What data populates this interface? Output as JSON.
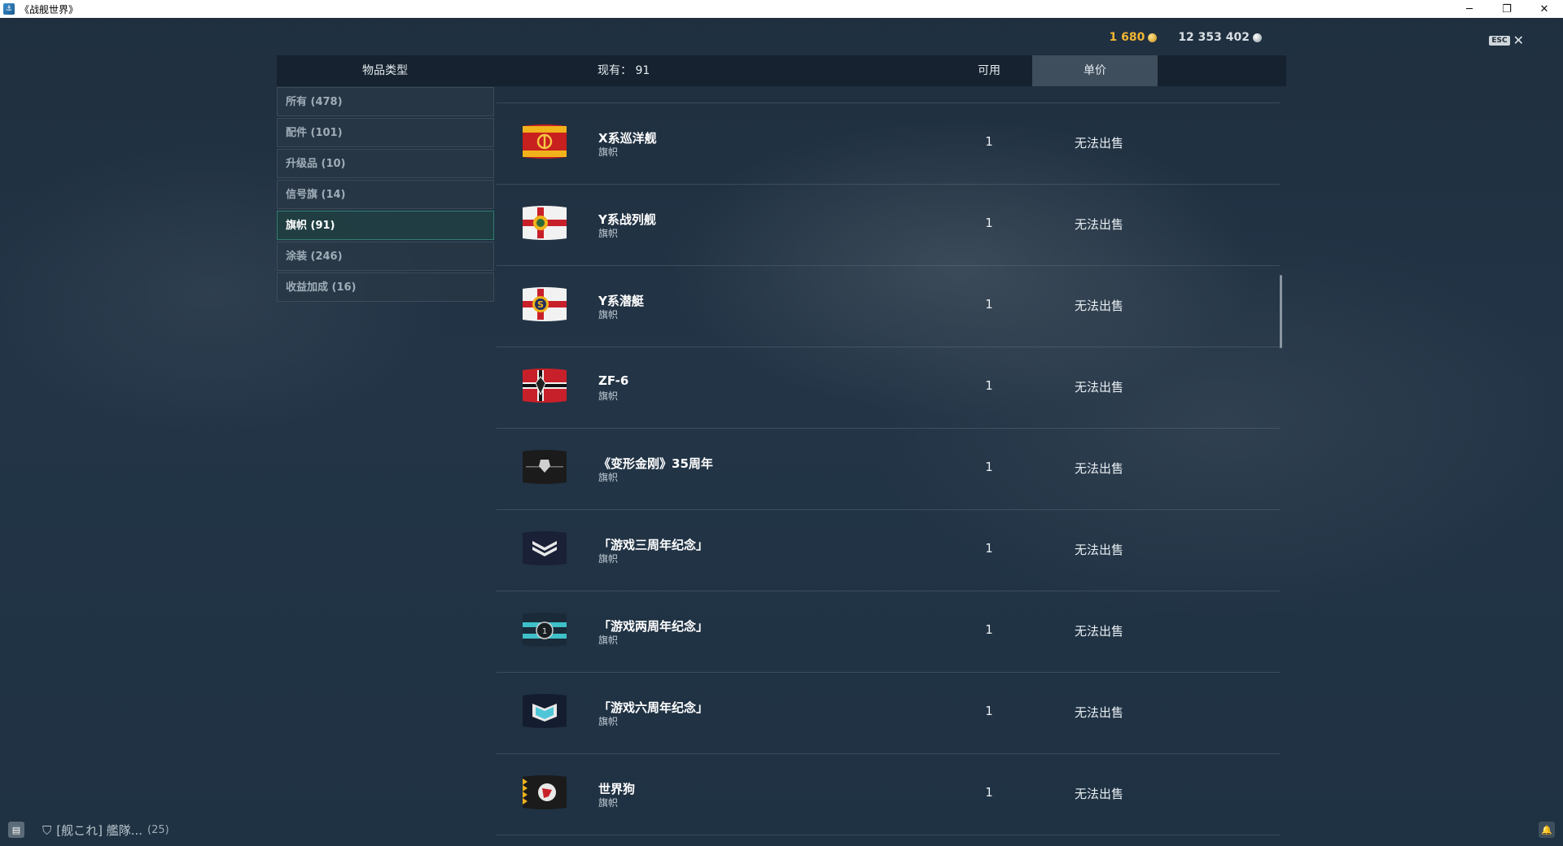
{
  "window": {
    "title": "《战舰世界》",
    "controls": {
      "minimize": "─",
      "restore": "❐",
      "close": "✕"
    }
  },
  "currency": {
    "gold": "1 680",
    "silver": "12 353 402"
  },
  "esc": {
    "badge": "ESC",
    "close": "✕"
  },
  "header": {
    "item_type": "物品类型",
    "count": "现有： 91",
    "available": "可用",
    "unit_price": "单价"
  },
  "categories": [
    {
      "label": "所有 (478)",
      "active": false
    },
    {
      "label": "配件 (101)",
      "active": false
    },
    {
      "label": "升级品 (10)",
      "active": false
    },
    {
      "label": "信号旗 (14)",
      "active": false
    },
    {
      "label": "旗帜 (91)",
      "active": true
    },
    {
      "label": "涂装 (246)",
      "active": false
    },
    {
      "label": "收益加成 (16)",
      "active": false
    }
  ],
  "items": [
    {
      "name": "X系巡洋舰",
      "type": "旗帜",
      "qty": "1",
      "price": "无法出售",
      "icon": "red-anchor-flag"
    },
    {
      "name": "Y系战列舰",
      "type": "旗帜",
      "qty": "1",
      "price": "无法出售",
      "icon": "white-cross-crest-flag"
    },
    {
      "name": "Y系潜艇",
      "type": "旗帜",
      "qty": "1",
      "price": "无法出售",
      "icon": "white-cross-s-emblem-flag"
    },
    {
      "name": "ZF-6",
      "type": "旗帜",
      "qty": "1",
      "price": "无法出售",
      "icon": "red-black-cross-emblem-flag"
    },
    {
      "name": "《变形金刚》35周年",
      "type": "旗帜",
      "qty": "1",
      "price": "无法出售",
      "icon": "black-transformers-flag"
    },
    {
      "name": "「游戏三周年纪念」",
      "type": "旗帜",
      "qty": "1",
      "price": "无法出售",
      "icon": "navy-chevron-flag"
    },
    {
      "name": "「游戏两周年纪念」",
      "type": "旗帜",
      "qty": "1",
      "price": "无法出售",
      "icon": "teal-anniversary-flag"
    },
    {
      "name": "「游戏六周年纪念」",
      "type": "旗帜",
      "qty": "1",
      "price": "无法出售",
      "icon": "navy-book-flag"
    },
    {
      "name": "世界狗",
      "type": "旗帜",
      "qty": "1",
      "price": "无法出售",
      "icon": "black-dog-flag"
    }
  ],
  "bottom": {
    "chat_icon": "chat-icon",
    "clan_text": "[舰これ] 艦隊...",
    "clan_count": "(25)"
  },
  "colors": {
    "gold": "#f2b632",
    "active_category_border": "#2f7c70",
    "header_bg": "#16222e"
  }
}
